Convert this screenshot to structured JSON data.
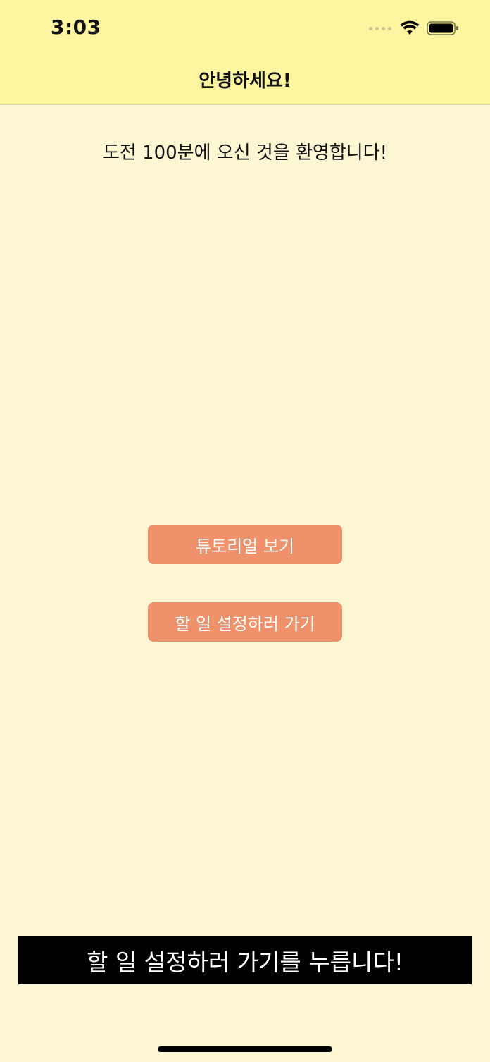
{
  "status_bar": {
    "time": "3:03",
    "wifi_icon": "wifi-icon",
    "battery_icon": "battery-icon"
  },
  "nav": {
    "title": "안녕하세요!"
  },
  "main": {
    "welcome_text": "도전 100분에 오신 것을 환영합니다!",
    "tutorial_button": "튜토리얼 보기",
    "set_todo_button": "할 일 설정하러 가기"
  },
  "caption": {
    "text": "할 일 설정하러 가기를 누릅니다!"
  },
  "colors": {
    "background": "#fcf6d3",
    "header": "#fdf59f",
    "button": "#ef916b",
    "caption_bg": "#000000"
  }
}
